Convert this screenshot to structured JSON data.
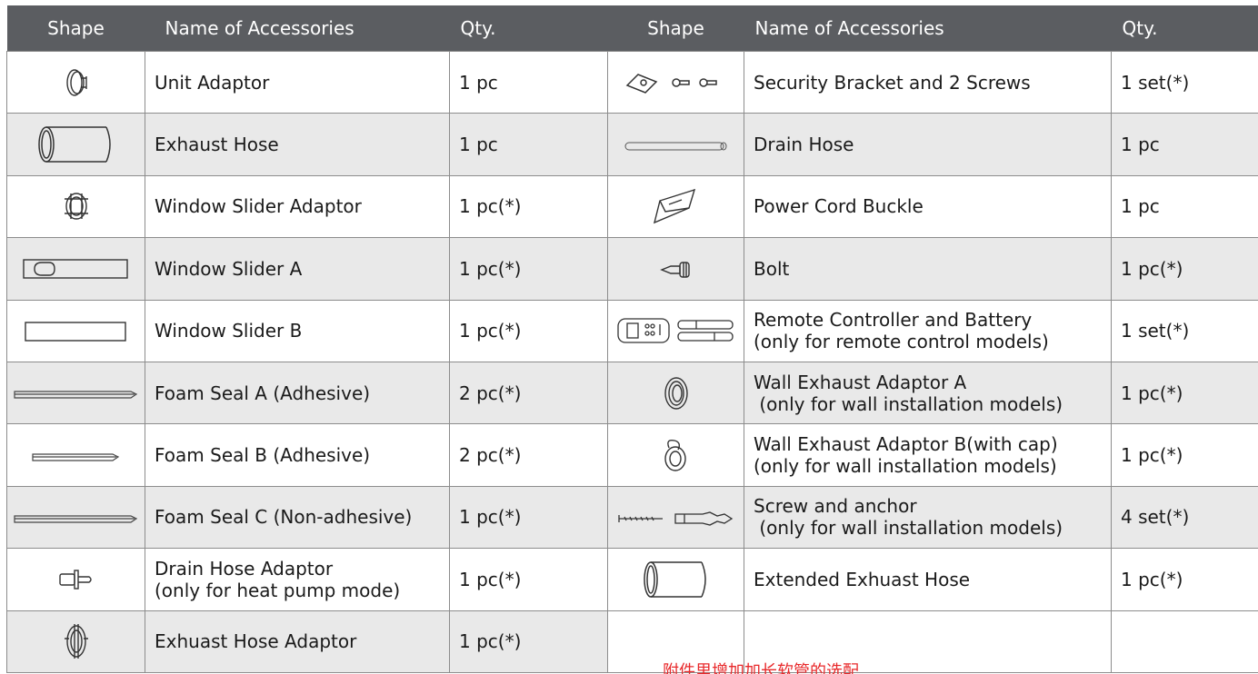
{
  "header": {
    "shape": "Shape",
    "name": "Name of Accessories",
    "qty": "Qty."
  },
  "left": [
    {
      "icon": "unit-adaptor-icon",
      "name": "Unit Adaptor",
      "name2": "",
      "qty": "1 pc"
    },
    {
      "icon": "exhaust-hose-icon",
      "name": "Exhaust Hose",
      "name2": "",
      "qty": "1 pc"
    },
    {
      "icon": "window-slider-adaptor-icon",
      "name": "Window Slider Adaptor",
      "name2": "",
      "qty": "1 pc(*)"
    },
    {
      "icon": "window-slider-a-icon",
      "name": "Window Slider A",
      "name2": "",
      "qty": "1 pc(*)"
    },
    {
      "icon": "window-slider-b-icon",
      "name": "Window Slider B",
      "name2": "",
      "qty": "1 pc(*)"
    },
    {
      "icon": "foam-seal-a-icon",
      "name": "Foam Seal A (Adhesive)",
      "name2": "",
      "qty": "2 pc(*)"
    },
    {
      "icon": "foam-seal-b-icon",
      "name": "Foam Seal B (Adhesive)",
      "name2": "",
      "qty": "2 pc(*)"
    },
    {
      "icon": "foam-seal-c-icon",
      "name": "Foam Seal C (Non-adhesive)",
      "name2": "",
      "qty": "1 pc(*)"
    },
    {
      "icon": "drain-hose-adaptor-icon",
      "name": "Drain Hose Adaptor",
      "name2": "(only for heat pump mode)",
      "qty": "1 pc(*)"
    },
    {
      "icon": "exhaust-hose-adaptor-icon",
      "name": "Exhuast Hose Adaptor",
      "name2": "",
      "qty": "1 pc(*)"
    }
  ],
  "right": [
    {
      "icon": "security-bracket-icon",
      "name": "Security Bracket and 2 Screws",
      "name2": "",
      "qty": "1 set(*)"
    },
    {
      "icon": "drain-hose-icon",
      "name": "Drain Hose",
      "name2": "",
      "qty": "1 pc"
    },
    {
      "icon": "power-cord-buckle-icon",
      "name": "Power Cord Buckle",
      "name2": "",
      "qty": "1 pc"
    },
    {
      "icon": "bolt-icon",
      "name": "Bolt",
      "name2": "",
      "qty": "1 pc(*)"
    },
    {
      "icon": "remote-controller-icon",
      "name": "Remote Controller and Battery",
      "name2": "(only for remote control models)",
      "qty": "1 set(*)"
    },
    {
      "icon": "wall-exhaust-adaptor-a-icon",
      "name": "Wall Exhaust Adaptor A",
      "name2": " (only for wall installation models)",
      "qty": "1 pc(*)"
    },
    {
      "icon": "wall-exhaust-adaptor-b-icon",
      "name": "Wall Exhaust Adaptor B(with cap)",
      "name2": "(only for wall installation models)",
      "qty": "1 pc(*)"
    },
    {
      "icon": "screw-anchor-icon",
      "name": "Screw and anchor",
      "name2": " (only for wall installation models)",
      "qty": "4 set(*)"
    },
    {
      "icon": "extended-exhaust-hose-icon",
      "name": "Extended Exhuast Hose",
      "name2": "",
      "qty": "1 pc(*)"
    },
    {
      "icon": "",
      "name": "",
      "name2": "",
      "qty": ""
    }
  ],
  "overlay_note": "附件里增加加长软管的选配",
  "colors": {
    "header_bg": "#5b5d61",
    "alt_row": "#e9e9e9",
    "border": "#8c8c8c",
    "note": "#e8292b"
  }
}
